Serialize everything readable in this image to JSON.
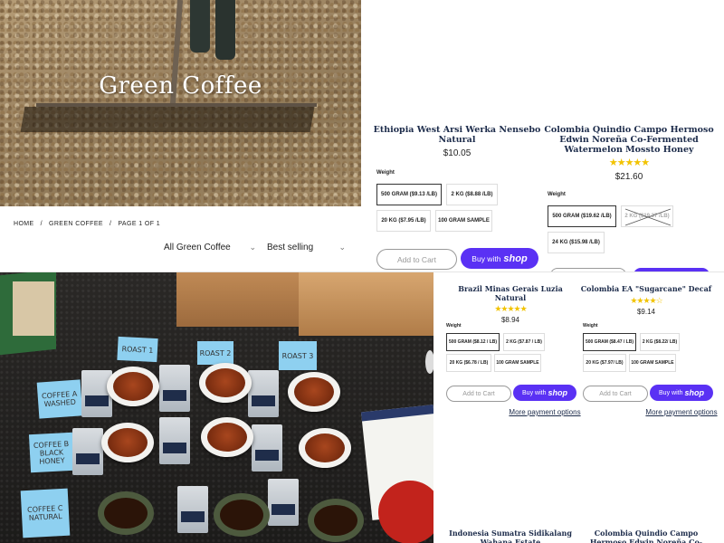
{
  "back_window": {
    "hero": {
      "title": "Green Coffee"
    },
    "breadcrumb": {
      "home": "HOME",
      "sep": "/",
      "collection": "GREEN COFFEE",
      "page": "PAGE 1 OF 1"
    },
    "filters": {
      "collection_value": "All Green Coffee",
      "sort_value": "Best selling"
    },
    "products": [
      {
        "title": "Ethiopia West Arsi Werka Nensebo Natural",
        "price": "$10.05",
        "weight_label": "Weight",
        "options": [
          "500 GRAM ($9.13 /LB)",
          "2 KG ($8.88 /LB)",
          "20 KG ($7.95 /LB)",
          "100 GRAM SAMPLE"
        ],
        "add_to_cart": "Add to Cart",
        "buy_with": "Buy with",
        "shop_brand": "shop"
      },
      {
        "title": "Colombia Quindio Campo Hermoso Edwin Noreña Co-Fermented Watermelon Mossto Honey",
        "rating": "4.5 of 5",
        "stars": "★★★★★",
        "price": "$21.60",
        "weight_label": "Weight",
        "options": [
          "500 GRAM ($19.62 /LB)",
          "2 KG ($19.37 /LB)",
          "24 KG ($15.98 /LB)"
        ]
      }
    ]
  },
  "front_window": {
    "photo": {
      "sticky_notes": [
        "ROAST 1",
        "ROAST 2",
        "ROAST 3",
        "COFFEE A WASHED",
        "COFFEE B BLACK HONEY",
        "COFFEE C NATURAL"
      ],
      "bag_labels": [
        "hacea",
        "hacea",
        "hacea",
        "hacea",
        "hacea",
        "hacea"
      ]
    },
    "products": [
      {
        "title": "Brazil Minas Gerais Luzia Natural",
        "stars": "★★★★★",
        "price": "$8.94",
        "weight_label": "Weight",
        "options": [
          "500 GRAM ($8.12 / LB)",
          "2 KG ($7.87 / LB)",
          "20 KG ($6.78 / LB)",
          "100 GRAM SAMPLE"
        ],
        "add_to_cart": "Add to Cart",
        "buy_with": "Buy with",
        "shop_brand": "shop",
        "more_payment": "More payment options"
      },
      {
        "title": "Colombia EA \"Sugarcane\" Decaf",
        "stars": "★★★★☆",
        "price": "$9.14",
        "weight_label": "Weight",
        "options": [
          "500 GRAM ($8.47 / LB)",
          "2 KG ($8.22/ LB)",
          "20 KG ($7.97/ LB)",
          "100 GRAM SAMPLE"
        ],
        "add_to_cart": "Add to Cart",
        "buy_with": "Buy with",
        "shop_brand": "shop",
        "more_payment": "More payment options"
      },
      {
        "title": "Indonesia Sumatra Sidikalang Wahana Estate"
      },
      {
        "title": "Colombia Quindio Campo Hermoso Edwin Noreña Co-Fermented Passion"
      }
    ]
  },
  "colors": {
    "accent_shop": "#5a31f4",
    "star": "#f2c300",
    "title_navy": "#1c2b4a"
  }
}
